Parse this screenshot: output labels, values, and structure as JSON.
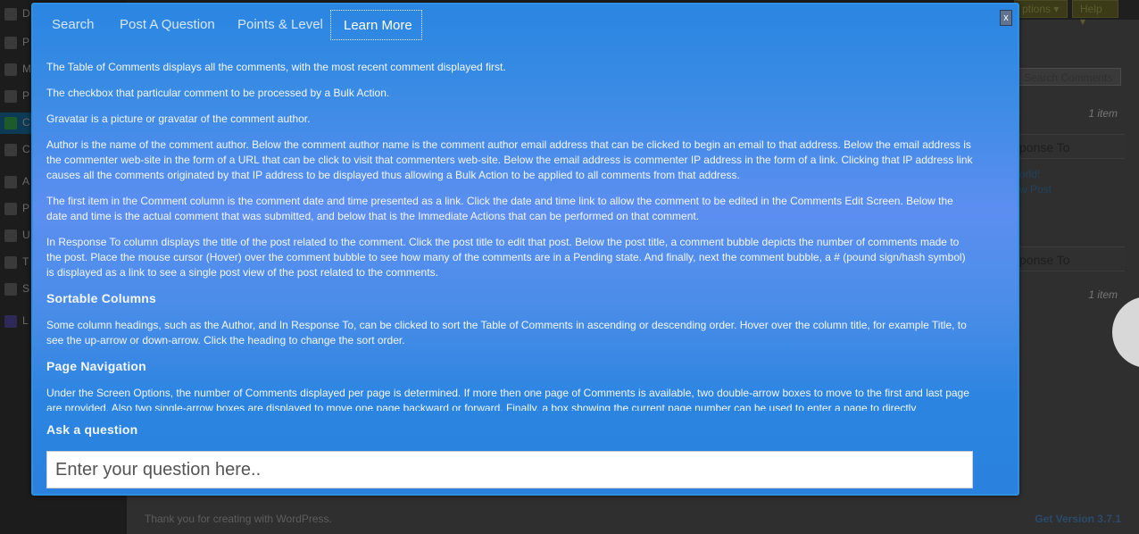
{
  "background": {
    "topbar_buttons": [
      "ptions",
      "Help"
    ],
    "sidebar_letters": [
      "D",
      "P",
      "M",
      "P",
      "C",
      "C",
      "A",
      "P",
      "U",
      "T",
      "S",
      "L"
    ],
    "search_comments_button": "Search Comments",
    "item_count_top": "1 item",
    "item_count_bottom": "1 item",
    "column_header_response_top": "ponse To",
    "column_header_response_bottom": "ponse To",
    "links": [
      "orld!",
      "w Post"
    ],
    "footer_left": "Thank you for creating with WordPress.",
    "footer_right": "Get Version 3.7.1"
  },
  "modal": {
    "tabs": [
      {
        "label": "Search",
        "active": false
      },
      {
        "label": "Post A Question",
        "active": false
      },
      {
        "label": "Points & Level",
        "active": false
      },
      {
        "label": "Learn More",
        "active": true
      }
    ],
    "close_label": "x",
    "paragraphs": [
      "The Table of Comments displays all the comments, with the most recent comment displayed first.",
      "The checkbox that particular comment to be processed by a Bulk Action.",
      "Gravatar is a picture or gravatar of the comment author.",
      "Author is the name of the comment author. Below the comment author name is the comment author email address that can be clicked to begin an email to that address. Below the email address is the commenter web-site in the form of a URL that can be click to visit that commenters web-site. Below the email address is commenter IP address in the form of a link. Clicking that IP address link causes all the comments originated by that IP address to be displayed thus allowing a Bulk Action to be applied to all comments from that address.",
      "The first item in the Comment column is the comment date and time presented as a link. Click the date and time link to allow the comment to be edited in the Comments Edit Screen. Below the date and time is the actual comment that was submitted, and below that is the Immediate Actions that can be performed on that comment.",
      "In Response To column displays the title of the post related to the comment. Click the post title to edit that post. Below the post title, a comment bubble depicts the number of comments made to the post. Place the mouse cursor (Hover) over the comment bubble to see how many of the comments are in a Pending state. And finally, next the comment bubble, a # (pound sign/hash symbol) is displayed as a link to see a single post view of the post related to the comments."
    ],
    "sortable": {
      "heading": "Sortable Columns",
      "text": "Some column headings, such as the Author, and In Response To, can be clicked to sort the Table of Comments in ascending or descending order. Hover over the column title, for example Title, to see the up-arrow or down-arrow. Click the heading to change the sort order."
    },
    "navigation": {
      "heading": "Page Navigation",
      "text": "Under the Screen Options, the number of Comments displayed per page is determined. If more then one page of Comments is available, two double-arrow boxes to move to the first and last page are provided. Also two single-arrow boxes are displayed to move one page backward or forward. Finally, a box showing the current page number can be used to enter a page to directly"
    },
    "ask": {
      "title": "Ask a question",
      "placeholder": "Enter your question here.."
    }
  }
}
